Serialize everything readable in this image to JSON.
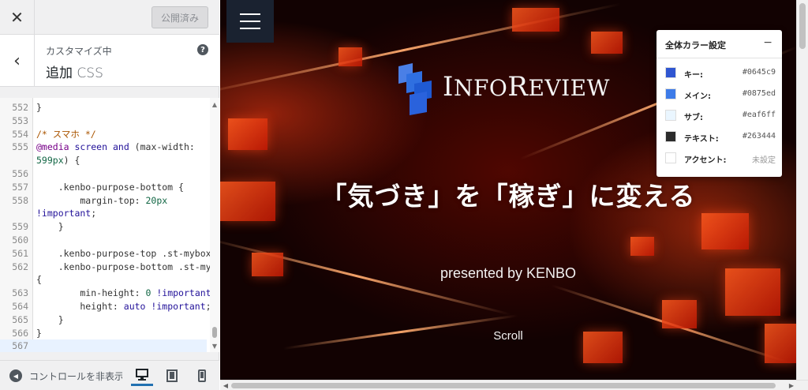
{
  "topbar": {
    "close_glyph": "✕",
    "publish_label": "公開済み"
  },
  "section": {
    "back_glyph": "‹",
    "sub_label": "カスタマイズ中",
    "title_ja": "追加",
    "title_en": "CSS",
    "help_glyph": "?"
  },
  "editor": {
    "lines": [
      {
        "no": "552",
        "text": "}"
      },
      {
        "no": "553",
        "text": ""
      },
      {
        "no": "554",
        "text": "/* スマホ */"
      },
      {
        "no": "555",
        "text": "@media screen and (max-width:"
      },
      {
        "no": "",
        "text": "599px) {"
      },
      {
        "no": "556",
        "text": ""
      },
      {
        "no": "557",
        "text": "    .kenbo-purpose-bottom {"
      },
      {
        "no": "558",
        "text": "        margin-top: 20px"
      },
      {
        "no": "",
        "text": "!important;"
      },
      {
        "no": "559",
        "text": "    }"
      },
      {
        "no": "560",
        "text": ""
      },
      {
        "no": "561",
        "text": "    .kenbo-purpose-top .st-mybox,"
      },
      {
        "no": "562",
        "text": "    .kenbo-purpose-bottom .st-mybox"
      },
      {
        "no": "",
        "text": "{"
      },
      {
        "no": "563",
        "text": "        min-height: 0 !important;"
      },
      {
        "no": "564",
        "text": "        height: auto !important;"
      },
      {
        "no": "565",
        "text": "    }"
      },
      {
        "no": "566",
        "text": "}"
      },
      {
        "no": "567",
        "text": ""
      }
    ]
  },
  "footer": {
    "collapse_label": "コントロールを非表示"
  },
  "preview": {
    "logo_cap1": "I",
    "logo_rest1": "NFO",
    "logo_cap2": "R",
    "logo_rest2": "EVIEW",
    "hero_title": "「気づき」を「稼ぎ」に変える",
    "presented": "presented by KENBO",
    "scroll": "Scroll"
  },
  "color_panel": {
    "title": "全体カラー設定",
    "minimize_glyph": "−",
    "rows": [
      {
        "label": "キー:",
        "value": "#0645c9",
        "swatch": "#2f56d1"
      },
      {
        "label": "メイン:",
        "value": "#0875ed",
        "swatch": "#3d7be8"
      },
      {
        "label": "サブ:",
        "value": "#eaf6ff",
        "swatch": "#eaf6ff"
      },
      {
        "label": "テキスト:",
        "value": "#263444",
        "swatch": "#2b2b2b"
      },
      {
        "label": "アクセント:",
        "value": "未設定",
        "swatch": "#ffffff"
      }
    ]
  },
  "colors": {
    "accent": "#2271b1",
    "logo_blue": "#2f6fe0"
  },
  "icons": {
    "close": "close-icon",
    "back": "chevron-left-icon",
    "help": "help-icon",
    "collapse": "collapse-icon",
    "desktop": "desktop-icon",
    "tablet": "tablet-icon",
    "mobile": "mobile-icon",
    "menu": "hamburger-icon"
  }
}
